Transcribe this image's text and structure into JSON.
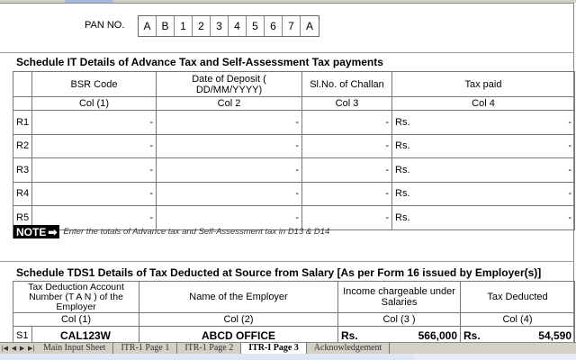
{
  "pan": {
    "label": "PAN NO.",
    "chars": [
      "A",
      "B",
      "1",
      "2",
      "3",
      "4",
      "5",
      "6",
      "7",
      "A"
    ]
  },
  "schedule_it": {
    "title": "Schedule IT   Details of Advance Tax and Self-Assessment Tax payments",
    "headers": [
      "BSR Code",
      "Date of Deposit ( DD/MM/YYYY)",
      "Sl.No. of Challan",
      "Tax paid"
    ],
    "col_labels": [
      "Col (1)",
      "Col 2",
      "Col 3",
      "Col 4"
    ],
    "rows": [
      {
        "id": "R1",
        "bsr": "-",
        "date": "-",
        "challan": "-",
        "rs": "Rs.",
        "tax": "-"
      },
      {
        "id": "R2",
        "bsr": "-",
        "date": "-",
        "challan": "-",
        "rs": "Rs.",
        "tax": "-"
      },
      {
        "id": "R3",
        "bsr": "-",
        "date": "-",
        "challan": "-",
        "rs": "Rs.",
        "tax": "-"
      },
      {
        "id": "R4",
        "bsr": "-",
        "date": "-",
        "challan": "-",
        "rs": "Rs.",
        "tax": "-"
      },
      {
        "id": "R5",
        "bsr": "-",
        "date": "-",
        "challan": "-",
        "rs": "Rs.",
        "tax": "-"
      }
    ]
  },
  "note": {
    "label": "NOTE",
    "arrow": "➡",
    "text": "Enter the totals of Advance tax and Self-Assessment tax in D13 & D14"
  },
  "schedule_tds1": {
    "title": "Schedule TDS1   Details of Tax Deducted at Source from Salary [As per Form 16 issued by Employer(s)]",
    "headers": [
      "Tax Deduction Account Number (T A N ) of the Employer",
      "Name of the Employer",
      "Income chargeable under Salaries",
      "Tax Deducted"
    ],
    "col_labels": [
      "Col (1)",
      "Col (2)",
      "Col (3 )",
      "Col (4)"
    ],
    "rows": [
      {
        "id": "S1",
        "tan": "CAL123W",
        "employer": "ABCD OFFICE",
        "rs1": "Rs.",
        "income": "566,000",
        "rs2": "Rs.",
        "tax": "54,590"
      }
    ]
  },
  "tabs": [
    "Main Input Sheet",
    "ITR-1 Page 1",
    "ITR-1 Page 2",
    "ITR-I Page 3",
    "Acknowledgement"
  ],
  "active_tab": "ITR-I Page 3"
}
